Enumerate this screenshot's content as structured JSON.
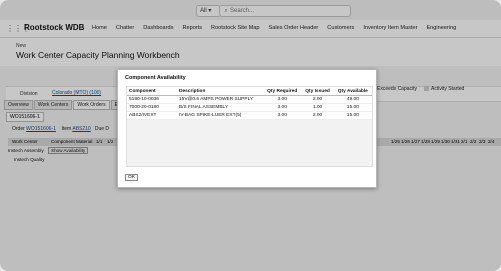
{
  "topbar": {
    "scope": "All",
    "search_placeholder": "Search..."
  },
  "nav": {
    "app_name": "Rootstock WDB",
    "items": [
      "Home",
      "Chatter",
      "Dashboards",
      "Reports",
      "Rootstock Site Map",
      "Sales Order Header",
      "Customers",
      "Inventory Item Master",
      "Engineering"
    ]
  },
  "page": {
    "small_label": "New",
    "title": "Work Center Capacity Planning Workbench"
  },
  "filter": {
    "division_label": "Division",
    "division_value": "Colorado (MTO) (100)"
  },
  "legend": {
    "exceeds": "Exceeds Capacity",
    "activity": "Activity Started"
  },
  "tabs": [
    "Overview",
    "Work Centers",
    "Work Orders",
    "Ex"
  ],
  "wo_tab": "WO151606-1",
  "order": {
    "order_label": "Order",
    "order_value": "WO151606-1",
    "item_label": "Item",
    "item_value": "ABS210",
    "due_label": "Due D"
  },
  "grid": {
    "headers": [
      "Work Center",
      "Component Material",
      "1/1",
      "1/2"
    ],
    "dates": [
      "1/25",
      "1/26",
      "1/27",
      "1/28",
      "1/29",
      "1/30",
      "1/31",
      "2/1",
      "2/2",
      "2/3",
      "2/4"
    ],
    "rows": [
      {
        "name": "Instech Assembly",
        "button": "Show Availability"
      },
      {
        "name": "Instech Quality",
        "button": ""
      }
    ]
  },
  "modal": {
    "title": "Component Availability",
    "columns": [
      "Component",
      "Description",
      "Qty Required",
      "Qty Issued",
      "Qty Available"
    ],
    "rows": [
      [
        "5190-10-0036",
        "15V@0.6 AMPS POWER SUPPLY",
        "3.00",
        "2.00",
        "49.00"
      ],
      [
        "7000-20-0180",
        "B/S FINAL ASSEMBLY",
        "3.00",
        "1.00",
        "15.00"
      ],
      [
        "ABS2/IVEXT",
        "IV-BAG SPIKE-LUER EXT(5)",
        "3.00",
        "2.00",
        "15.00"
      ]
    ],
    "ok_label": "OK"
  },
  "colors": {
    "exceeds": "#e07b7b",
    "activity": "#cfcfcf"
  }
}
